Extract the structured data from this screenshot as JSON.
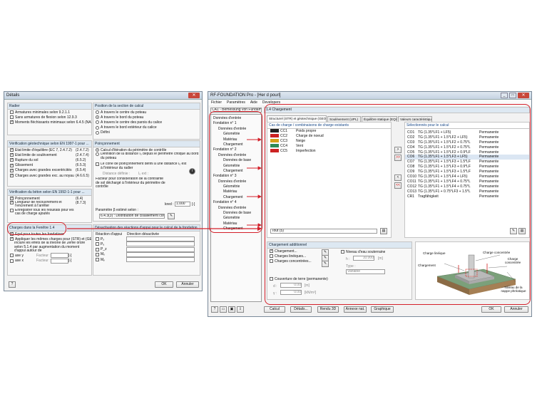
{
  "details": {
    "title": "Détails",
    "radier": {
      "header": "Radier",
      "rows": [
        {
          "label": "Armatures minimales selon 9.2.1.1",
          "checked": false
        },
        {
          "label": "Sans armatures de flexion selon 12.9.3",
          "checked": false
        },
        {
          "label": "Moments fléchissants minimaux selon 6.4.5 (NA.6)",
          "checked": true
        }
      ]
    },
    "position": {
      "header": "Position de la section de calcul",
      "options": [
        "À travers le centre du poteau",
        "À travers le bord du poteau",
        "À travers le centre des parois du calice",
        "À travers le bord extérieur du calice",
        "Défini"
      ],
      "selected": 1
    },
    "geotech": {
      "header": "Vérification géotechnique selon EN 1997-1 pour ...",
      "rows": [
        {
          "label": "État limite d'équilibre (EC 7, 2.4.7.2)",
          "ref": "(2.4.7.2)"
        },
        {
          "label": "État limite de soulèvement",
          "ref": "(2.4.7.4)"
        },
        {
          "label": "Rupture du sol",
          "ref": "(6.5.2)"
        },
        {
          "label": "Glissement",
          "ref": "(6.5.3)"
        },
        {
          "label": "Charges avec grandes excentricités",
          "ref": "(6.5.4)"
        },
        {
          "label": "Charges avec grandes exc. au noyau",
          "ref": "(A 6.6.5)"
        }
      ]
    },
    "beton": {
      "header": "Vérification du béton selon EN 1992-1-1 pour ...",
      "rows": [
        {
          "label": "Poinçonnement",
          "ref": "(6.4)"
        },
        {
          "label": "Longueur de recouvrement et l'encrement à l'arrêter",
          "ref": "(8.7.3)"
        },
        {
          "label": "Enregistrer tous les résultats pour les cas de charge ajoutés",
          "ref": ""
        }
      ]
    },
    "poinc": {
      "header": "Poinçonnement",
      "opt1": "Calcul d'itération du périmètre de contrôle",
      "opt2": "Définition de la distance l₀ depuis le périmètre critique au bord du poteau",
      "chk": "Le cône de poinçonnement défini à une distance l₀ est à l'intérieur du radier",
      "dist_label": "Distance définie :",
      "dist_sym": "l₀ ext :",
      "facteur_label": "Facteur pour considération de la contrainte de sol déchargé à l'intérieur du périmètre de contrôle",
      "kred_sym": "kred :",
      "kred_val": "1.000",
      "kred_unit": "[-]",
      "param_label": "Paramètre β estimé selon :",
      "param_val": "6.4.3(3) : Distribution de cisaillement complète"
    },
    "fenetre": {
      "header": "Charges dans la Fenêtre 1.4",
      "rows": [
        "Égal pour toutes les fondations",
        "Appliquer les mêmes charges pour (STR) et (GEO)",
        "Inclure les effets de la théorie de 2ème ordre selon 5.1.4 par augmentation du moment d'appui autour de"
      ]
    },
    "axes": [
      {
        "label": "axe y",
        "fac": "Facteur :",
        "unit": "[-]"
      },
      {
        "label": "axe x",
        "fac": "Facteur :",
        "unit": "[-]"
      }
    ],
    "desact": {
      "header": "Désactivation des réactions d'appui pour le calcul de la fondation",
      "col1": "Réaction d'appui",
      "col2": "Direction désactivée",
      "rows": [
        "Pₓ",
        "Pᵧ",
        "P_z",
        "Mₓ",
        "Mᵧ"
      ]
    },
    "ok": "OK",
    "cancel": "Annuler"
  },
  "rf": {
    "title": "RF-FOUNDATION Pro - [Her d pourl]",
    "menu": [
      "Fichier",
      "Paramètres",
      "Aide",
      "Developers"
    ],
    "ca": "CA1 - Bemessung von Fundame",
    "section": "1.4 Chargement",
    "tree": [
      {
        "t": "Données d'entrée",
        "i": 0
      },
      {
        "t": "Fondation n° 1",
        "i": 0
      },
      {
        "t": "Données d'entrée",
        "i": 1
      },
      {
        "t": "Géométrie",
        "i": 2
      },
      {
        "t": "Matériau",
        "i": 2
      },
      {
        "t": "Chargement",
        "i": 2
      },
      {
        "t": "Fondation n° 2",
        "i": 0
      },
      {
        "t": "Données d'entrée",
        "i": 1
      },
      {
        "t": "Données de base",
        "i": 2
      },
      {
        "t": "Géométrie",
        "i": 2
      },
      {
        "t": "Chargement",
        "i": 2
      },
      {
        "t": "Fondation n° 3",
        "i": 0
      },
      {
        "t": "Données d'entrée",
        "i": 1
      },
      {
        "t": "Géométrie",
        "i": 2
      },
      {
        "t": "Matériau",
        "i": 2
      },
      {
        "t": "Chargement",
        "i": 2
      },
      {
        "t": "Fondation n° 4",
        "i": 0
      },
      {
        "t": "Données d'entrée",
        "i": 1
      },
      {
        "t": "Données de base",
        "i": 2
      },
      {
        "t": "Géométrie",
        "i": 2
      },
      {
        "t": "Matériau",
        "i": 2
      },
      {
        "t": "Chargement",
        "i": 2
      }
    ],
    "tabs": [
      "Structurel (STR) et géotechnique (GEO)",
      "Soulèvement (UPL)",
      "Équilibre statique (EQU)",
      "Valeurs caractéristiques"
    ],
    "existing": {
      "header": "Cas de charge / combinaisons de charge existants",
      "rows": [
        {
          "c": "CC1",
          "d": "Poids propre",
          "color": "#222222"
        },
        {
          "c": "CC2",
          "d": "Charge de noeud",
          "color": "#cc2222"
        },
        {
          "c": "CC3",
          "d": "Neige",
          "color": "#d4a017"
        },
        {
          "c": "CC4",
          "d": "Vent",
          "color": "#2e8b57"
        },
        {
          "c": "CC5",
          "d": "Imperfection",
          "color": "#cc2222"
        }
      ],
      "filter": "Tout (5)"
    },
    "selected": {
      "header": "Sélectionnés pour le calcul",
      "rows": [
        {
          "c": "CO1",
          "f": "TG  (1.35*LF1 + LF5)",
          "t": "Permanente"
        },
        {
          "c": "CO2",
          "f": "TG  (1.35*LF1 + 1.5*LF2 + LF5)",
          "t": "Permanente"
        },
        {
          "c": "CO3",
          "f": "TG  (1.35*LF1 + 1.5*LF2 + 0.75*L",
          "t": "Permanente"
        },
        {
          "c": "CO4",
          "f": "TG  (1.35*LF1 + 1.5*LF2 + 0.75*L",
          "t": "Permanente"
        },
        {
          "c": "CO5",
          "f": "TG  (1.35*LF1 + 1.5*LF2 + 0.9*LF",
          "t": "Permanente"
        },
        {
          "c": "CO6",
          "f": "TG  (1.35*LF1 + 1.5*LF3 + LF5)",
          "t": "Permanente"
        },
        {
          "c": "CO7",
          "f": "TG  (1.35*LF1 + 1.5*LF3 + 1.5*LF",
          "t": "Permanente"
        },
        {
          "c": "CO8",
          "f": "TG  (1.35*LF1 + 1.5*LF3 + 0.9*LF",
          "t": "Permanente"
        },
        {
          "c": "CO9",
          "f": "TG  (1.35*LF1 + 1.5*LF3 + 1.5*LF",
          "t": "Permanente"
        },
        {
          "c": "CO10",
          "f": "TG  (1.35*LF1 + 1.5*LF4 + LF5)",
          "t": "Permanente"
        },
        {
          "c": "CO11",
          "f": "TG  (1.35*LF1 + 1.5*LF4 + 0.75*L",
          "t": "Permanente"
        },
        {
          "c": "CO12",
          "f": "TG  (1.35*LF1 + 1.5*LF4 + 0.75*L",
          "t": "Permanente"
        },
        {
          "c": "CO13",
          "f": "TG  (1.35*LF1 + 0.75*LF3 + 1.5*L",
          "t": "Permanente"
        },
        {
          "c": "CR1",
          "f": "Tragfähigkeit",
          "t": "Permanente"
        }
      ]
    },
    "add": {
      "header": "Chargement additionnel",
      "rows": [
        "Chargement...",
        "Charges linéiques...",
        "Charges concentrées..."
      ],
      "nappe": "Niveau d'eau souterraine",
      "h_val": "10.000",
      "h_unit": "[m]",
      "type_lbl": "Type :",
      "type_val": "Variable",
      "couv": "Couverture de terre (permanente)",
      "d_val": "0.00",
      "d_unit": "[m]",
      "g_val": "0.00",
      "g_unit": "[kN/m³]"
    },
    "diagram": {
      "c1": "Charge linéique",
      "c2": "Charge concentrée",
      "c3": "Charge concentrée",
      "c4": "Chargement",
      "c5": "Niveau de la nappe phréatique"
    },
    "buttons": [
      "Calcul",
      "Détails...",
      "Rendu 3D",
      "Annexe nat.",
      "Graphique"
    ],
    "ok": "OK",
    "cancel": "Annuler"
  }
}
